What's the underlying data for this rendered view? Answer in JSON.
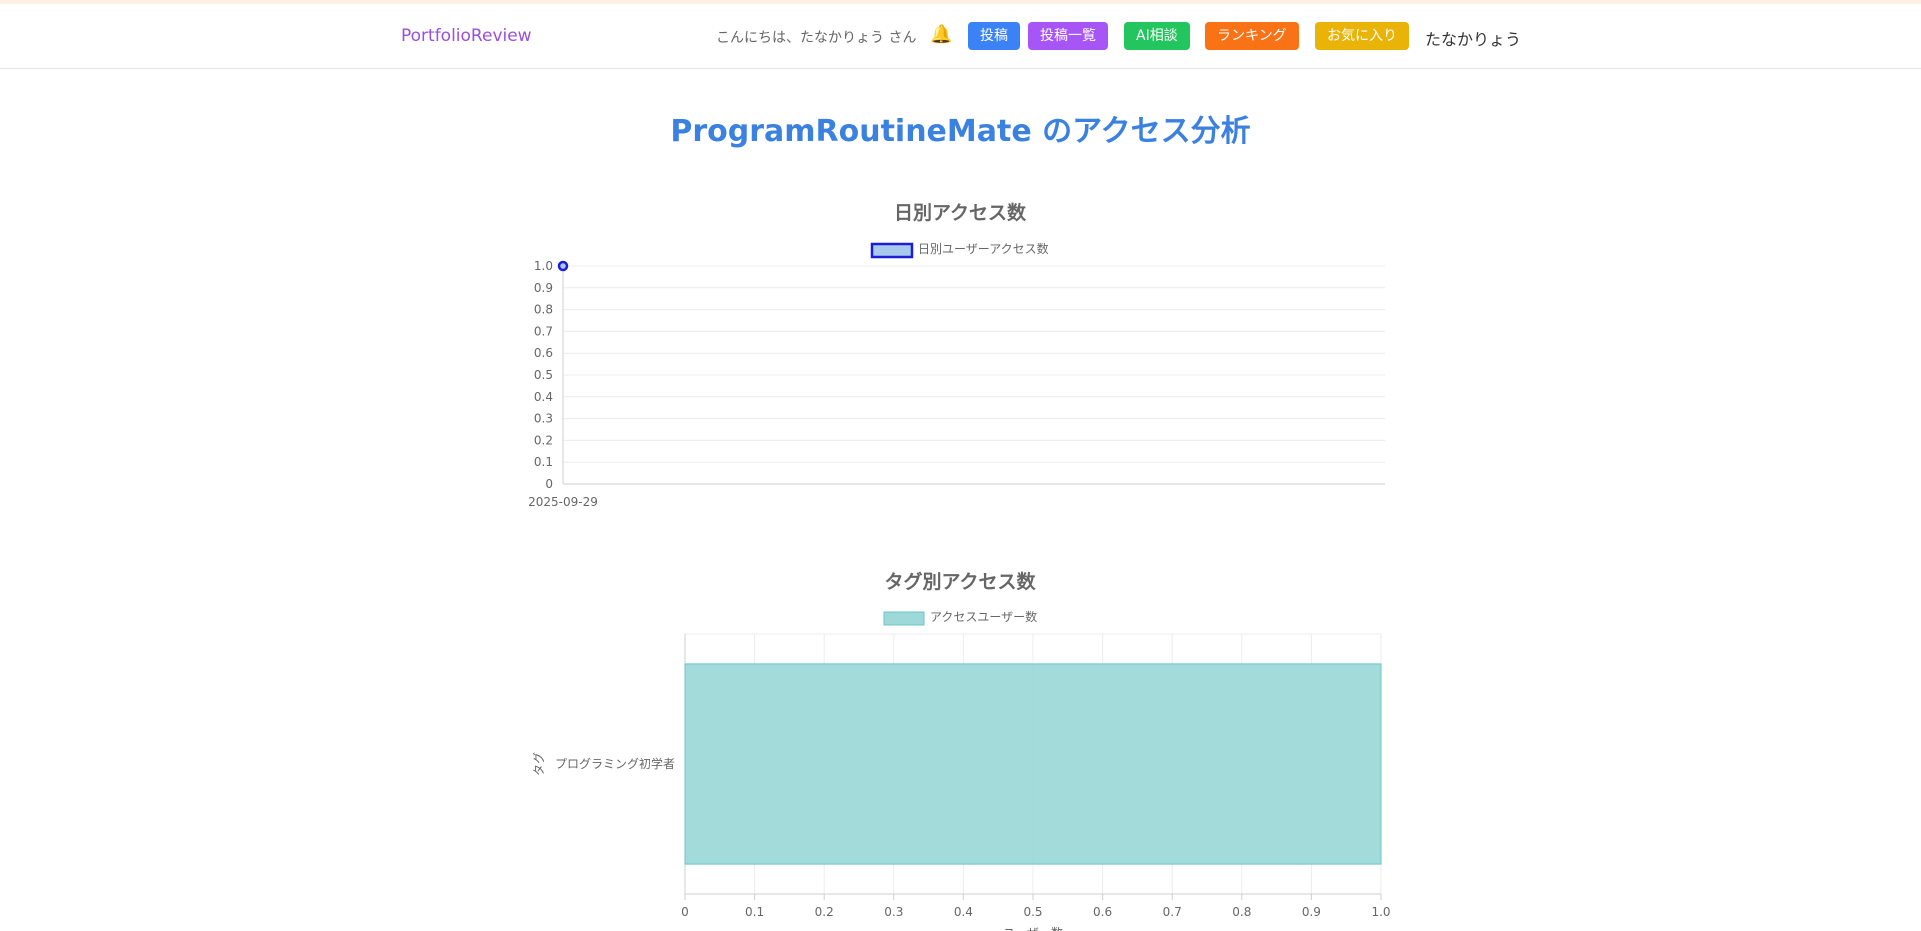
{
  "header": {
    "brand": "PortfolioReview",
    "greeting": "こんにちは、たなかりょう さん",
    "bell_icon": "bell-icon",
    "buttons": [
      {
        "label": "投稿",
        "color": "#3b82f6"
      },
      {
        "label": "投稿一覧",
        "color": "#a855f7"
      },
      {
        "label": "AI相談",
        "color": "#22c55e"
      },
      {
        "label": "ランキング",
        "color": "#f97316"
      },
      {
        "label": "お気に入り",
        "color": "#eab308"
      }
    ],
    "username": "たなかりょう"
  },
  "page": {
    "title": "ProgramRoutineMate のアクセス分析"
  },
  "chart_data": [
    {
      "type": "line",
      "title": "日別アクセス数",
      "x": [
        "2025-09-29"
      ],
      "series": [
        {
          "name": "日別ユーザーアクセス数",
          "values": [
            1
          ],
          "color": "#1d1dd8",
          "fill": "#a9c9ec"
        }
      ],
      "ylim": [
        0,
        1.0
      ],
      "yticks": [
        "0",
        "0.1",
        "0.2",
        "0.3",
        "0.4",
        "0.5",
        "0.6",
        "0.7",
        "0.8",
        "0.9",
        "1.0"
      ],
      "legend": "top",
      "grid": true
    },
    {
      "type": "bar",
      "orientation": "horizontal",
      "title": "タグ別アクセス数",
      "categories": [
        "プログラミング初学者"
      ],
      "series": [
        {
          "name": "アクセスユーザー数",
          "values": [
            1
          ],
          "color": "#9ed9d9",
          "border": "#6cc4c4"
        }
      ],
      "xlim": [
        0,
        1.0
      ],
      "xticks": [
        "0",
        "0.1",
        "0.2",
        "0.3",
        "0.4",
        "0.5",
        "0.6",
        "0.7",
        "0.8",
        "0.9",
        "1.0"
      ],
      "ylabel": "タグ",
      "xlabel": "ユーザー数",
      "legend": "top",
      "grid": true
    }
  ]
}
